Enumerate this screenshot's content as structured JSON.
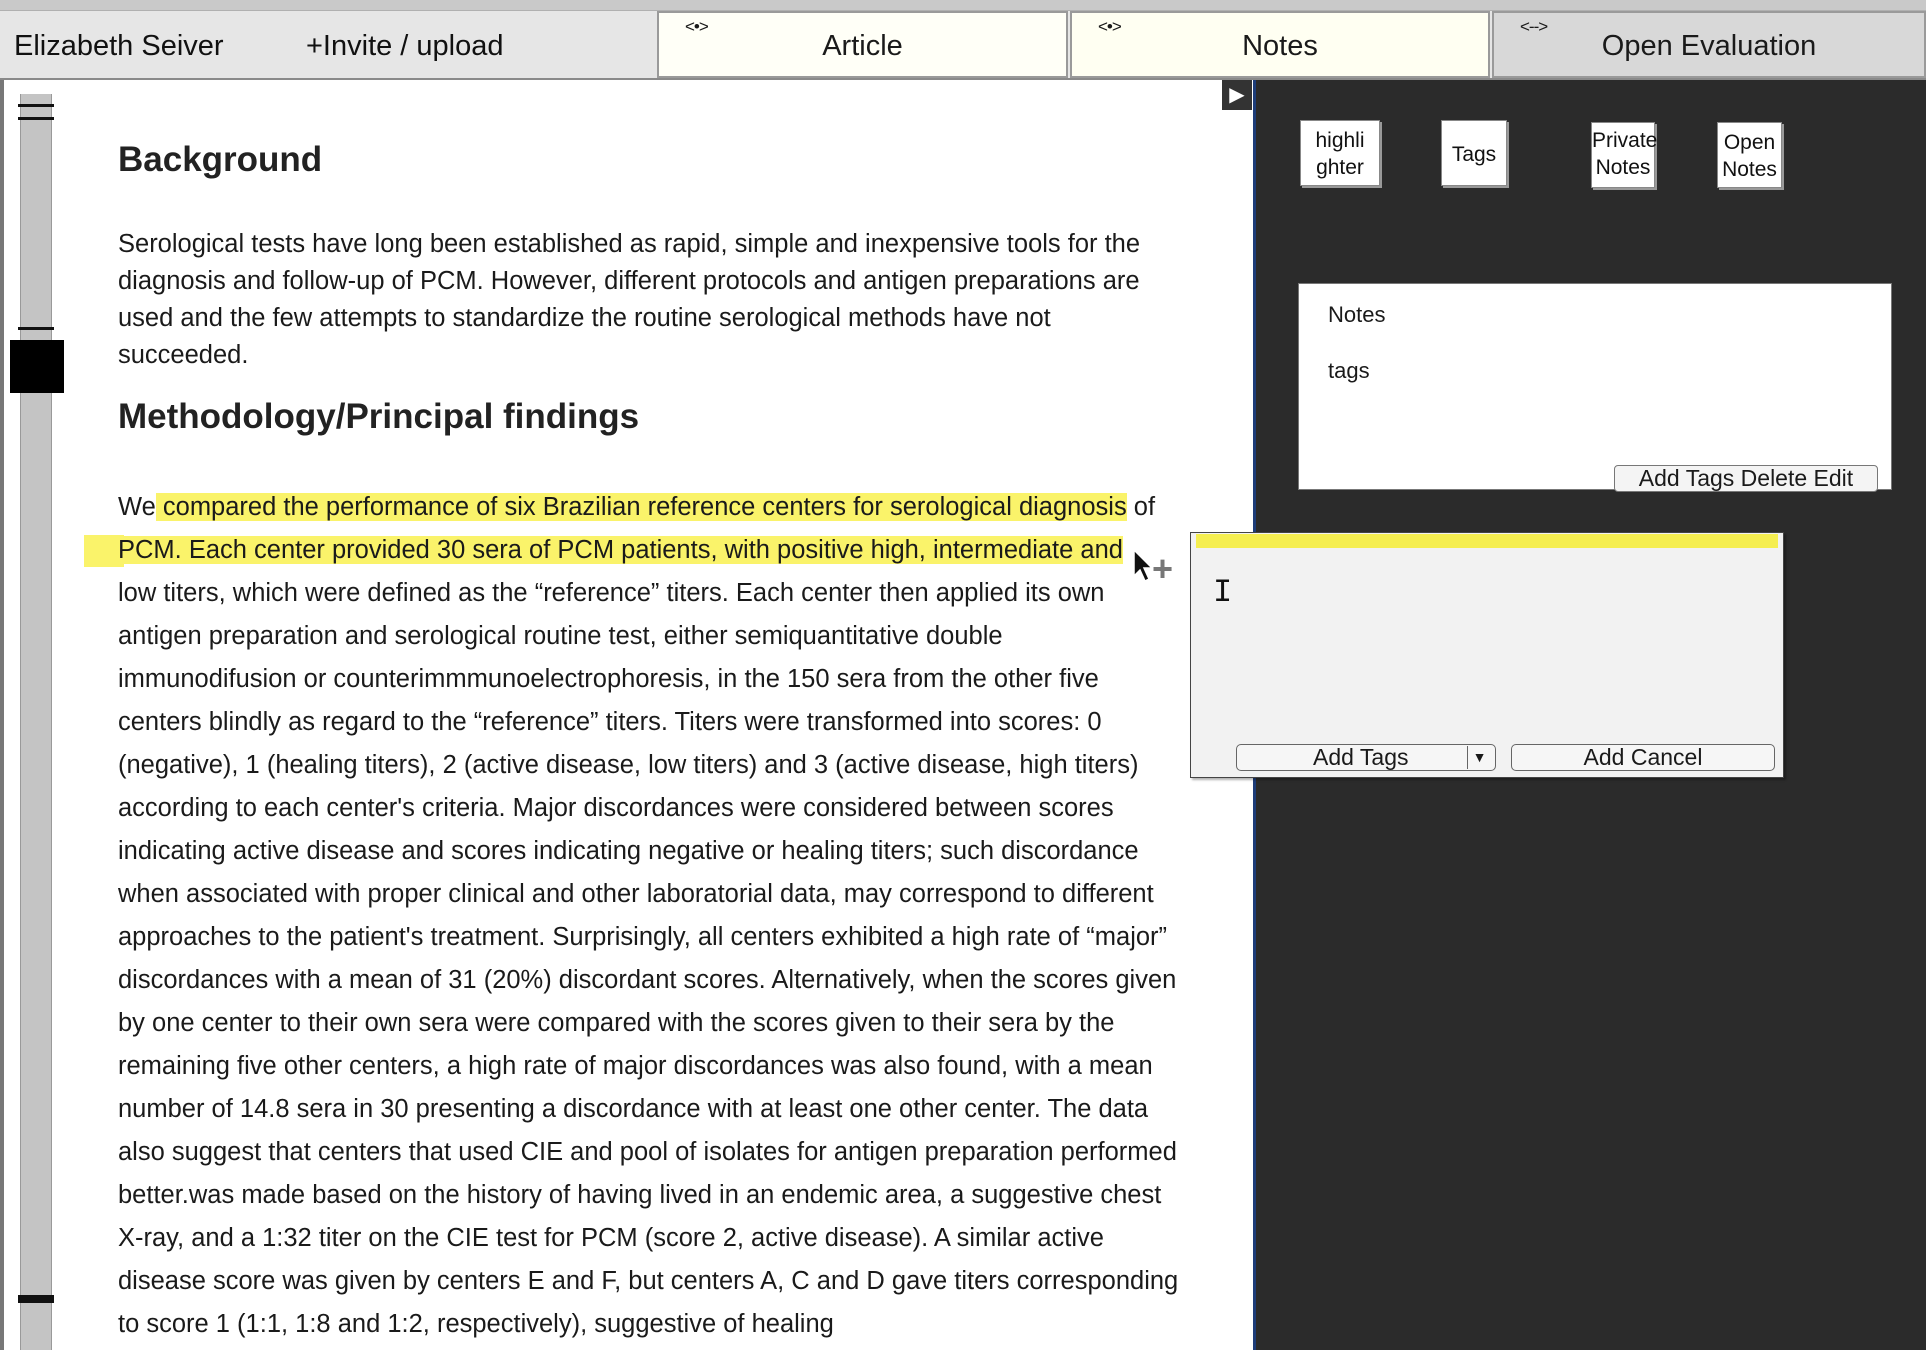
{
  "header": {
    "username": "Elizabeth Seiver",
    "invite_upload": "+Invite  / upload",
    "tabs": [
      {
        "arrows": "<•>",
        "label": "Article"
      },
      {
        "arrows": "<•>",
        "label": "Notes"
      },
      {
        "arrows": "<-->",
        "label": "Open Evaluation"
      }
    ]
  },
  "article": {
    "background_heading": "Background",
    "background_text": "Serological tests have long been established as rapid, simple and inexpensive tools for the diagnosis and follow-up of PCM. However, different protocols and antigen preparations are used and the few attempts to standardize the routine serological methods have not succeeded.",
    "methodology_heading": "Methodology/Principal findings",
    "methodology_pre": "We",
    "methodology_highlight_1": " compared the performance of six Brazilian reference centers for serological diagnosis",
    "methodology_mid": " of",
    "methodology_highlight_2": "PCM. Each center provided 30 sera of PCM patients, with positive high, intermediate and",
    "methodology_rest": "low titers, which were defined as the “reference” titers. Each center then applied its own antigen preparation and serological routine test, either semiquantitative double immunodifusion or counterimmmunoelectrophoresis, in the 150 sera from the other five centers blindly as regard to the “reference” titers. Titers were transformed into scores: 0 (negative), 1 (healing titers), 2 (active disease, low titers) and 3 (active disease, high titers) according to each center's criteria. Major discordances were considered between scores indicating active disease and scores indicating negative or healing titers; such discordance when associated with proper clinical and other laboratorial data, may correspond to different approaches to the patient's treatment. Surprisingly, all centers exhibited a high rate of “major” discordances with a mean of 31 (20%) discordant scores. Alternatively, when the scores given by one center to their own sera were compared with the scores given to their sera by the remaining five other centers, a high rate of major discordances was also found, with a mean number of 14.8 sera in 30 presenting a discordance with at least one other center. The data also suggest that centers that used CIE and pool of isolates for antigen preparation performed better.was made based on the history of having lived in an endemic area, a suggestive chest X-ray, and a 1:32 titer on the CIE test for PCM (score 2, active disease). A similar active disease score was given by centers E and F, but centers A, C and D gave titers corresponding to score 1 (1:1, 1:8 and 1:2, respectively), suggestive of healing"
  },
  "sidebar": {
    "buttons": [
      "highli ghter",
      "Tags",
      "Private Notes",
      "Open Notes"
    ],
    "notes_card": {
      "notes_label": "Notes",
      "tags_label": "tags",
      "actions": "Add Tags Delete  Edit"
    }
  },
  "popup": {
    "tags_label": "Add  Tags",
    "actions": "Add  Cancel"
  },
  "icons": {
    "toggle": "play-triangle-icon",
    "cursor": "arrow-cursor-icon",
    "plus": "plus-icon",
    "text_caret": "text-caret-icon"
  },
  "colors": {
    "highlight": "#faf36a",
    "sidebar_bg": "#2b2b2b",
    "header_bg": "#e6e6e6"
  }
}
